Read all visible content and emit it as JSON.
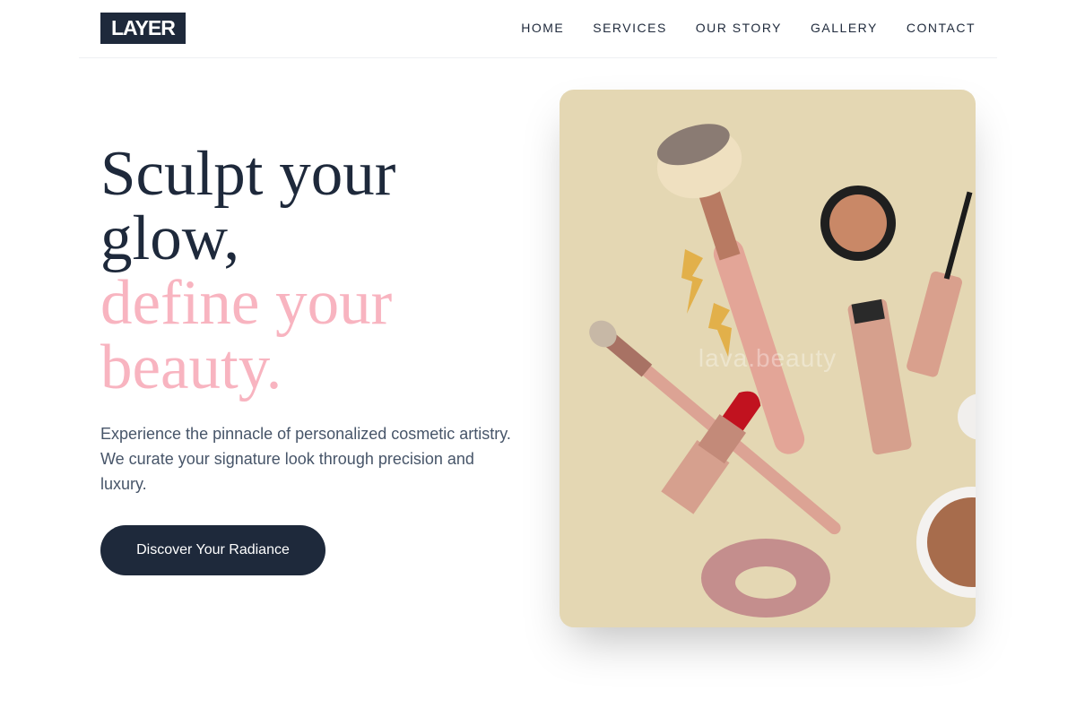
{
  "header": {
    "logo": "LAYER",
    "nav": [
      "HOME",
      "SERVICES",
      "OUR STORY",
      "GALLERY",
      "CONTACT"
    ]
  },
  "hero": {
    "title_line1": "Sculpt your glow,",
    "title_line2": "define your beauty.",
    "description": "Experience the pinnacle of personalized cosmetic artistry. We curate your signature look through precision and luxury.",
    "cta_label": "Discover Your Radiance"
  },
  "image": {
    "watermark": "lava.beauty"
  },
  "colors": {
    "primary": "#1e293b",
    "accent_pink": "#f8b4c0",
    "image_background": "#e4d7b3"
  }
}
